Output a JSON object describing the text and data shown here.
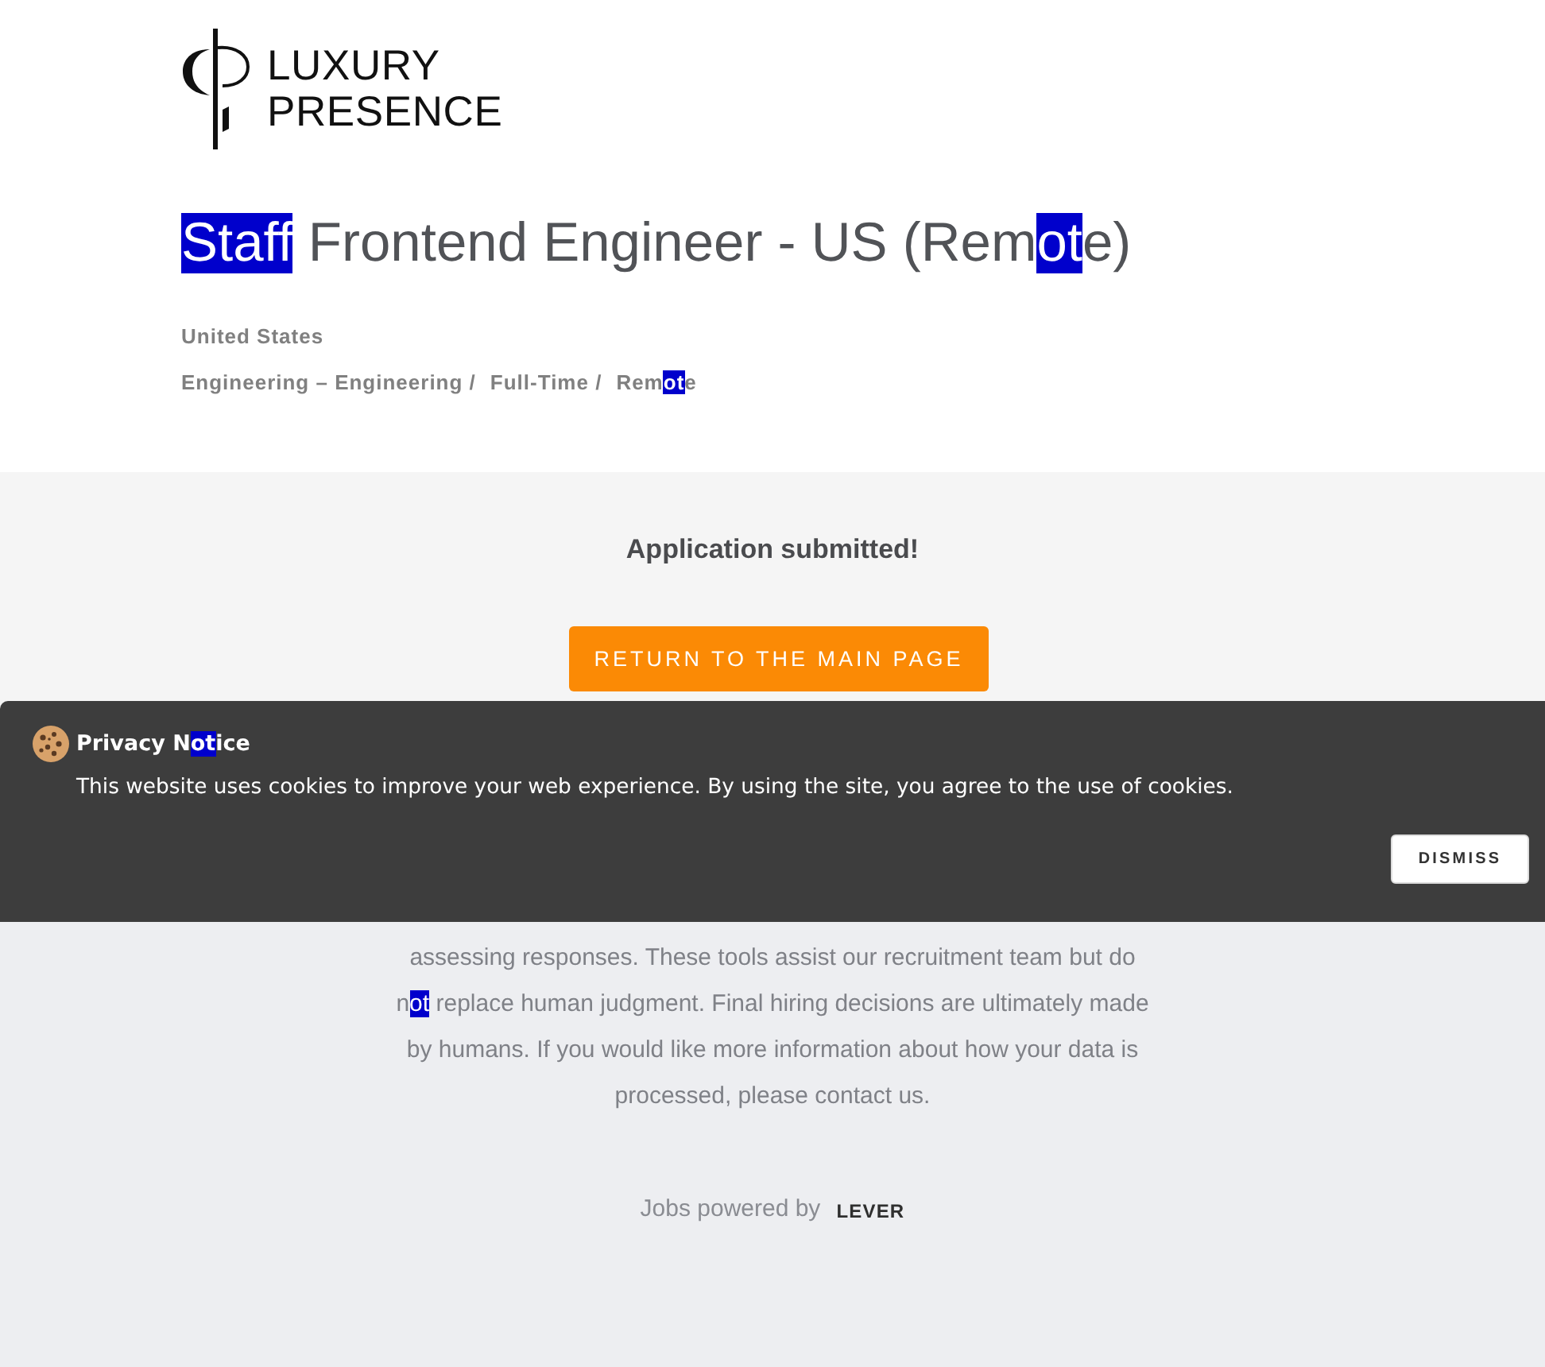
{
  "logo": {
    "wordmark_lines": [
      "LUXURY",
      "PRESENCE"
    ]
  },
  "job": {
    "title": {
      "parts": [
        {
          "text": "Staff",
          "highlighted": true
        },
        {
          "text": " Frontend Engineer - US (Rem",
          "highlighted": false
        },
        {
          "text": "ot",
          "highlighted": true
        },
        {
          "text": "e)",
          "highlighted": false
        }
      ]
    },
    "location": "United States",
    "categories": [
      {
        "parts": [
          {
            "text": "Engineering – Engineering /",
            "highlighted": false
          }
        ]
      },
      {
        "parts": [
          {
            "text": "Full-Time /",
            "highlighted": false
          }
        ]
      },
      {
        "parts": [
          {
            "text": "Rem",
            "highlighted": false
          },
          {
            "text": "ot",
            "highlighted": true
          },
          {
            "text": "e",
            "highlighted": false
          }
        ]
      }
    ]
  },
  "submission": {
    "message": "Application submitted!",
    "button": "RETURN TO THE MAIN PAGE"
  },
  "ai_notice": {
    "parts": [
      {
        "text": "assessing responses. These tools assist our recruitment team but do n",
        "highlighted": false
      },
      {
        "text": "ot",
        "highlighted": true
      },
      {
        "text": " replace human judgment. Final hiring decisions are ultimately made by humans. If you would like more information about how your data is processed, please contact us.",
        "highlighted": false
      }
    ]
  },
  "footer": {
    "powered_by": "Jobs powered by",
    "brand": "LEVER"
  },
  "cookie_banner": {
    "title": {
      "parts": [
        {
          "text": "Privacy N",
          "highlighted": false
        },
        {
          "text": "ot",
          "highlighted": true
        },
        {
          "text": "ice",
          "highlighted": false
        }
      ]
    },
    "message": "This website uses cookies to improve your web experience. By using the site, you agree to the use of cookies.",
    "button": "DISMISS"
  }
}
